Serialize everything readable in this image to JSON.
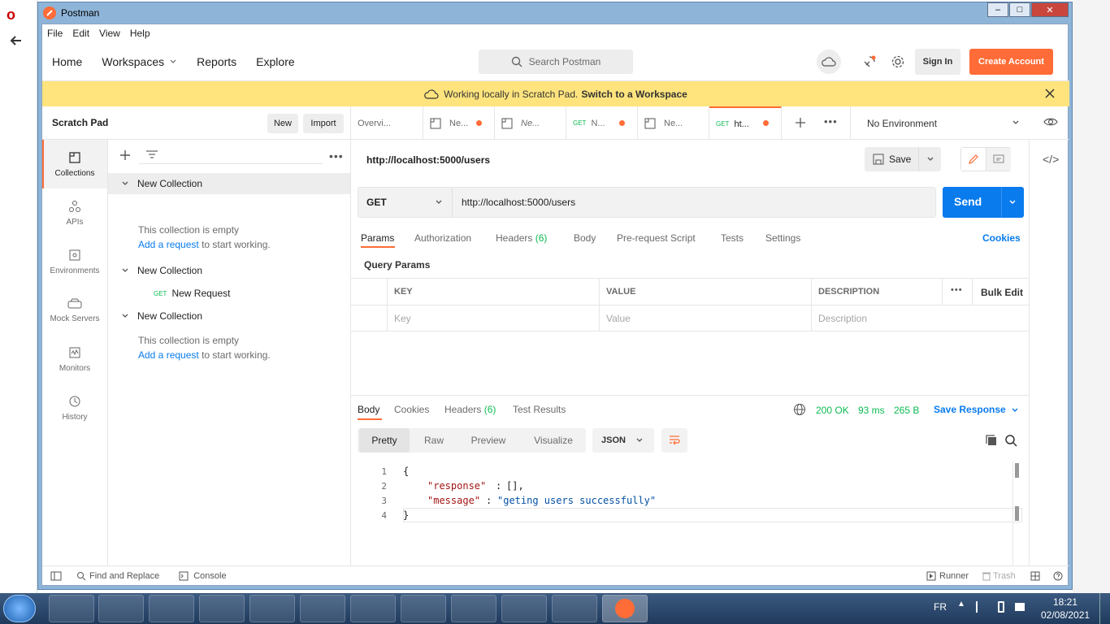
{
  "window": {
    "title": "Postman"
  },
  "menubar": [
    "File",
    "Edit",
    "View",
    "Help"
  ],
  "header": {
    "nav": [
      "Home",
      "Workspaces",
      "Reports",
      "Explore"
    ],
    "search_placeholder": "Search Postman",
    "signin": "Sign In",
    "create_account": "Create Account"
  },
  "banner": {
    "text": "Working locally in Scratch Pad.",
    "link": "Switch to a Workspace"
  },
  "sidebar": {
    "title": "Scratch Pad",
    "new_btn": "New",
    "import_btn": "Import",
    "rail": [
      "Collections",
      "APIs",
      "Environments",
      "Mock Servers",
      "Monitors",
      "History"
    ],
    "tree": {
      "c1": "New Collection",
      "empty1": "This collection is empty",
      "add1_link": "Add a request",
      "add1_rest": "to start working.",
      "c2": "New Collection",
      "req_method": "GET",
      "req_name": "New Request",
      "c3": "New Collection",
      "empty3": "This collection is empty",
      "add3_link": "Add a request",
      "add3_rest": "to start working."
    }
  },
  "tabs": {
    "t1": "Overvi...",
    "t2": "Ne...",
    "t3": "Ne...",
    "t4_method": "GET",
    "t4": "N...",
    "t5": "Ne...",
    "t6_method": "GET",
    "t6": "ht...",
    "environment": "No Environment"
  },
  "request": {
    "title": "http://localhost:5000/users",
    "save": "Save",
    "method": "GET",
    "url": "http://localhost:5000/users",
    "send": "Send",
    "subtabs": {
      "params": "Params",
      "auth": "Authorization",
      "headers": "Headers",
      "headers_count": "(6)",
      "body": "Body",
      "prereq": "Pre-request Script",
      "tests": "Tests",
      "settings": "Settings",
      "cookies": "Cookies"
    },
    "query_params_label": "Query Params",
    "grid": {
      "key": "KEY",
      "value": "VALUE",
      "description": "DESCRIPTION",
      "bulk_edit": "Bulk Edit",
      "key_ph": "Key",
      "value_ph": "Value",
      "desc_ph": "Description"
    }
  },
  "response": {
    "tabs": {
      "body": "Body",
      "cookies": "Cookies",
      "headers": "Headers",
      "headers_count": "(6)",
      "tests": "Test Results"
    },
    "status": "200 OK",
    "time": "93 ms",
    "size": "265 B",
    "save_response": "Save Response",
    "views": [
      "Pretty",
      "Raw",
      "Preview",
      "Visualize"
    ],
    "format": "JSON",
    "lines": [
      "1",
      "2",
      "3",
      "4"
    ],
    "code": {
      "l1": "{",
      "k2": "\"response\"",
      "v2": "[],",
      "k3": "\"message\"",
      "v3": "\"geting users successfully\"",
      "l4": "}"
    }
  },
  "statusbar": {
    "find": "Find and Replace",
    "console": "Console",
    "runner": "Runner",
    "trash": "Trash"
  },
  "taskbar": {
    "lang": "FR",
    "time": "18:21",
    "date": "02/08/2021"
  },
  "colors": {
    "accent": "#ff6c37",
    "send": "#097bed",
    "get": "#0cbb52",
    "banner": "#ffe47e",
    "link": "#097bed",
    "ok": "#0cbb52"
  }
}
